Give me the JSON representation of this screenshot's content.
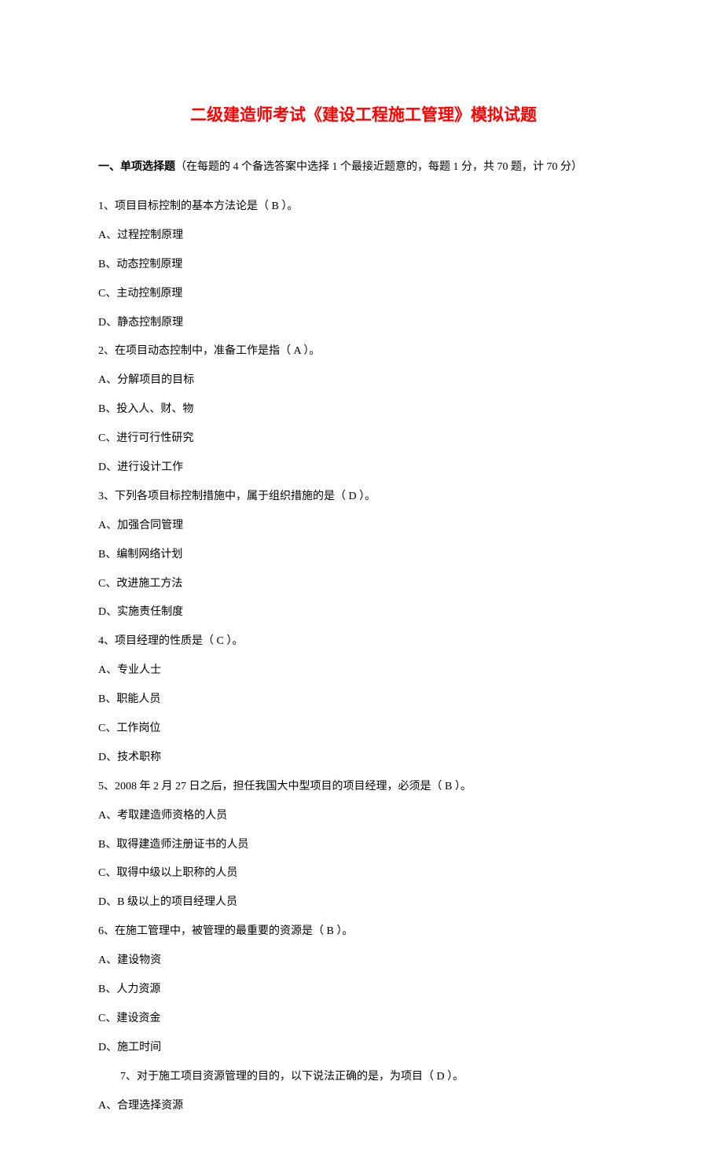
{
  "title": "二级建造师考试《建设工程施工管理》模拟试题",
  "section1": {
    "label": "一、单项选择题",
    "desc": "（在每题的 4 个备选答案中选择 1 个最接近题意的，每题 1 分，共 70 题，计 70 分）"
  },
  "q1": {
    "stem": "1、项目目标控制的基本方法论是（ B    ）。",
    "A": "A、过程控制原理",
    "B": "B、动态控制原理",
    "C": "C、主动控制原理",
    "D": "D、静态控制原理"
  },
  "q2": {
    "stem": "2、在项目动态控制中，准备工作是指（ A    ）。",
    "A": "A、分解项目的目标",
    "B": "B、投入人、财、物",
    "C": "C、进行可行性研究",
    "D": "D、进行设计工作"
  },
  "q3": {
    "stem": "3、下列各项目标控制措施中，属于组织措施的是（ D ）。",
    "A": "A、加强合同管理",
    "B": "B、编制网络计划",
    "C": "C、改进施工方法",
    "D": "D、实施责任制度"
  },
  "q4": {
    "stem": "4、项目经理的性质是（ C   ）。",
    "A": "A、专业人士",
    "B": "B、职能人员",
    "C": "C、工作岗位",
    "D": "D、技术职称"
  },
  "q5": {
    "stem": "5、2008 年 2 月 27 日之后，担任我国大中型项目的项目经理，必须是（   B ）。",
    "A": "A、考取建造师资格的人员",
    "B": "B、取得建造师注册证书的人员",
    "C": "C、取得中级以上职称的人员",
    "D": "D、B 级以上的项目经理人员"
  },
  "q6": {
    "stem": "6、在施工管理中，被管理的最重要的资源是（   B   ）。",
    "A": "A、建设物资",
    "B": "B、人力资源",
    "C": "C、建设资金",
    "D": "D、施工时间"
  },
  "q7": {
    "stem": "7、对于施工项目资源管理的目的，以下说法正确的是，为项目（   D ）。",
    "A": "A、合理选择资源"
  }
}
